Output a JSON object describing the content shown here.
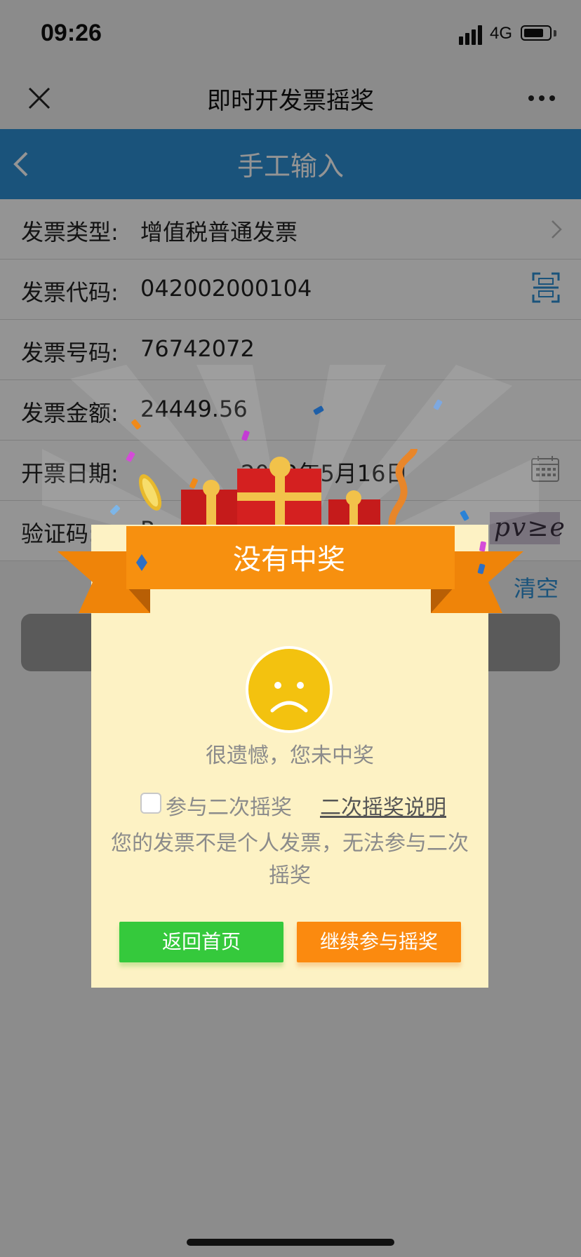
{
  "status": {
    "time": "09:26",
    "network": "4G"
  },
  "nav": {
    "title": "即时开发票摇奖",
    "close_icon": "close-icon",
    "more_icon": "more-icon"
  },
  "header": {
    "title": "手工输入",
    "back_icon": "chevron-left-icon"
  },
  "form": {
    "rows": [
      {
        "label": "发票类型:",
        "value": "增值税普通发票"
      },
      {
        "label": "发票代码:",
        "value": "042002000104"
      },
      {
        "label": "发票号码:",
        "value": "76742072"
      },
      {
        "label": "发票金额:",
        "value": "24449.56"
      },
      {
        "label": "开票日期:",
        "value": "2022年5月16日"
      },
      {
        "label": "验证码:",
        "value": "Pv"
      }
    ],
    "captcha_text": "pv≥e",
    "clear": "清空"
  },
  "modal": {
    "title": "没有中奖",
    "sorry": "很遗憾，您未中奖",
    "second_draw_label": "参与二次摇奖",
    "second_draw_link": "二次摇奖说明",
    "notice": "您的发票不是个人发票，无法参与二次摇奖",
    "btn_home": "返回首页",
    "btn_continue": "继续参与摇奖"
  },
  "colors": {
    "header_blue": "#2e8fd4",
    "ribbon_orange": "#f7900f",
    "modal_bg": "#fdf2c4",
    "btn_green": "#35c93c",
    "btn_orange": "#fb8a0f"
  }
}
